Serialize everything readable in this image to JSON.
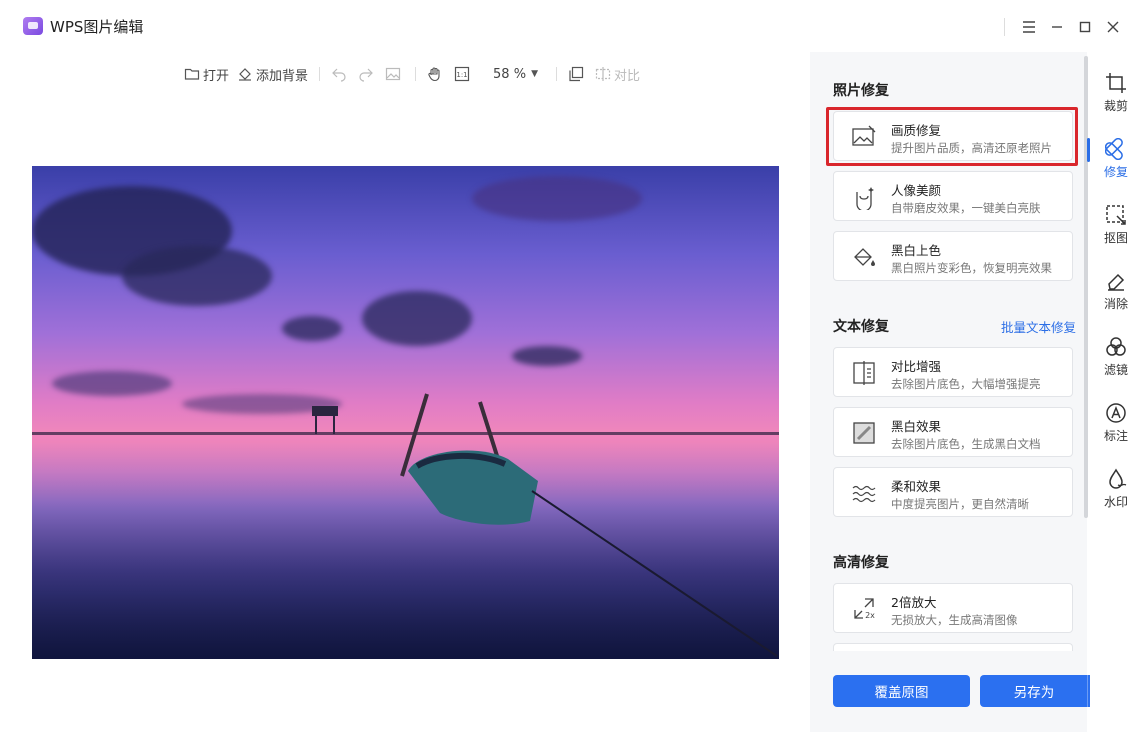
{
  "window": {
    "title": "WPS图片编辑"
  },
  "toolbar": {
    "open": "打开",
    "add_background": "添加背景",
    "zoom": "58 %",
    "compare": "对比"
  },
  "panel": {
    "photo_repair": {
      "title": "照片修复",
      "items": [
        {
          "title": "画质修复",
          "desc": "提升图片品质，高清还原老照片"
        },
        {
          "title": "人像美颜",
          "desc": "自带磨皮效果，一键美白亮肤"
        },
        {
          "title": "黑白上色",
          "desc": "黑白照片变彩色，恢复明亮效果"
        }
      ]
    },
    "text_repair": {
      "title": "文本修复",
      "link": "批量文本修复",
      "items": [
        {
          "title": "对比增强",
          "desc": "去除图片底色，大幅增强提亮"
        },
        {
          "title": "黑白效果",
          "desc": "去除图片底色，生成黑白文档"
        },
        {
          "title": "柔和效果",
          "desc": "中度提亮图片，更自然清晰"
        }
      ]
    },
    "hd_repair": {
      "title": "高清修复",
      "items": [
        {
          "title": "2倍放大",
          "desc": "无损放大，生成高清图像"
        }
      ]
    },
    "buttons": {
      "overwrite": "覆盖原图",
      "save_as": "另存为"
    }
  },
  "tools": [
    {
      "label": "裁剪",
      "icon": "crop-icon"
    },
    {
      "label": "修复",
      "icon": "repair-icon"
    },
    {
      "label": "抠图",
      "icon": "cutout-icon"
    },
    {
      "label": "消除",
      "icon": "eraser-icon"
    },
    {
      "label": "滤镜",
      "icon": "filter-icon"
    },
    {
      "label": "标注",
      "icon": "annotate-icon"
    },
    {
      "label": "水印",
      "icon": "watermark-icon"
    }
  ],
  "colors": {
    "accent": "#2b70f0",
    "highlight": "#d9262c"
  }
}
